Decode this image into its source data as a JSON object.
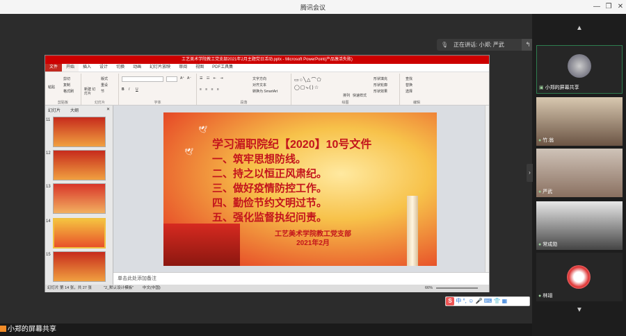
{
  "window": {
    "title": "腾讯会议"
  },
  "speaking": {
    "text": "正在讲话: 小郑; 严武"
  },
  "share": {
    "label": "小郑的屏幕共享"
  },
  "ppt": {
    "title": "工艺美术学院教工党支部2021年2月主题党日活动.pptx - Microsoft PowerPoint(产品激活失败)",
    "tabs": [
      "文件",
      "开始",
      "插入",
      "设计",
      "切换",
      "动画",
      "幻灯片放映",
      "审阅",
      "视图",
      "PDF工具集"
    ],
    "ribbon_groups": [
      "剪贴板",
      "幻灯片",
      "字体",
      "段落",
      "绘图",
      "编辑"
    ],
    "ribbon": {
      "paste": "粘贴",
      "cut": "剪切",
      "copy": "复制",
      "format_painter": "格式刷",
      "new_slide": "新建\n幻灯片",
      "layout": "版式",
      "reset": "重设",
      "section": "节",
      "text_direction": "文字方向",
      "align_text": "对齐文本",
      "smartart": "转换为 SmartArt",
      "arrange": "排列",
      "quick_styles": "快速样式",
      "fill": "形状填充",
      "outline": "形状轮廓",
      "effects": "形状效果",
      "find": "查找",
      "replace": "替换",
      "select": "选择"
    },
    "pane_tabs": [
      "幻灯片",
      "大纲"
    ],
    "thumbs": [
      {
        "num": "11",
        "selected": false
      },
      {
        "num": "12",
        "selected": false
      },
      {
        "num": "13",
        "selected": false
      },
      {
        "num": "14",
        "selected": true
      },
      {
        "num": "15",
        "selected": false
      }
    ],
    "slide": {
      "headline": "学习湄职院纪【2020】10号文件",
      "items": [
        "一、筑牢思想防线。",
        "二、持之以恒正风肃纪。",
        "三、做好疫情防控工作。",
        "四、勤俭节约文明过节。",
        "五、强化监督执纪问责。"
      ],
      "org": "工艺美术学院教工党支部",
      "date": "2021年2月"
    },
    "notes_placeholder": "单击此处添加备注",
    "status": {
      "slide": "幻灯片 第 14 张，共 27 张",
      "theme": "\"2_默认设计模板\"",
      "lang": "中文(中国)",
      "zoom": "66%"
    }
  },
  "participants": [
    {
      "name": "小郑的屏幕共享"
    },
    {
      "name": "竹.翁"
    },
    {
      "name": "严武"
    },
    {
      "name": "常成勋"
    },
    {
      "name": "林翊"
    }
  ],
  "ime": {
    "label": "中"
  },
  "colors": {
    "ppt_red": "#c00",
    "slide_text": "#c3141c",
    "active_speaker": "#2e7d4f"
  }
}
